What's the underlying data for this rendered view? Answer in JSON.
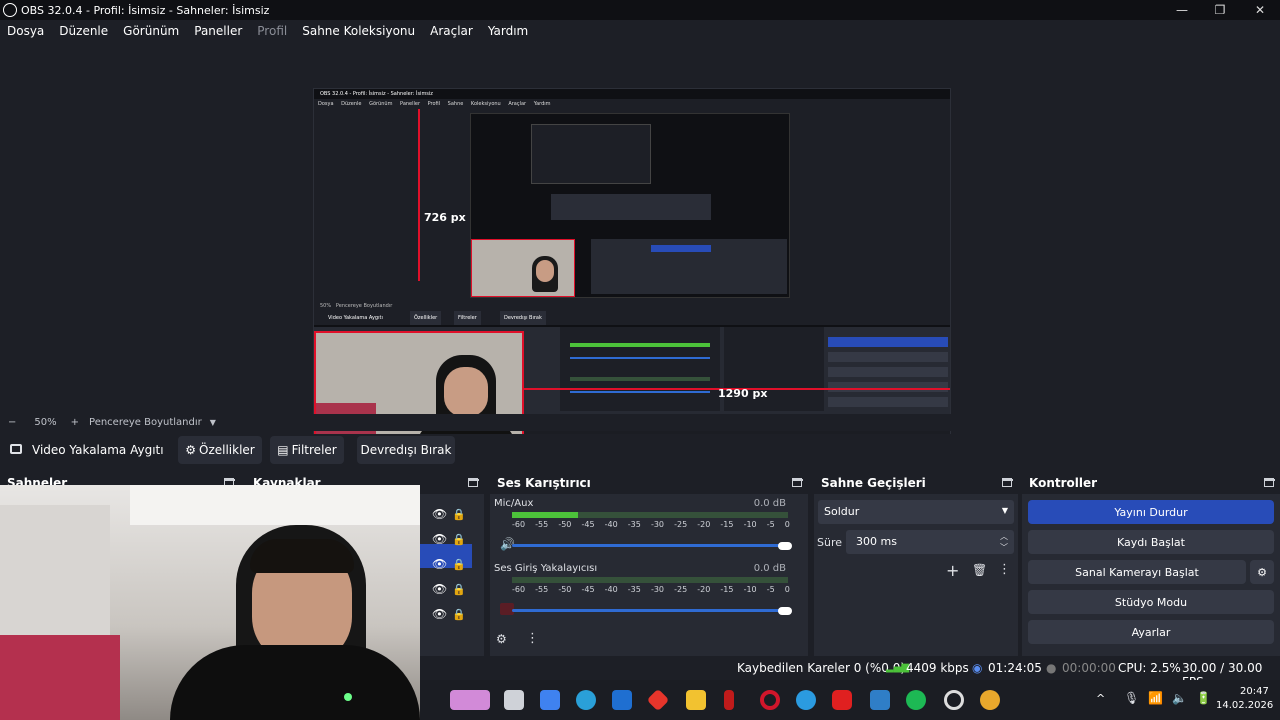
{
  "window": {
    "title": "OBS 32.0.4 - Profil: İsimsiz - Sahneler: İsimsiz",
    "minimize": "—",
    "maximize": "❐",
    "close": "✕"
  },
  "menu": [
    "Dosya",
    "Düzenle",
    "Görünüm",
    "Paneller",
    "Profil",
    "Sahne Koleksiyonu",
    "Araçlar",
    "Yardım"
  ],
  "preview": {
    "measure_vertical": "726 px",
    "measure_horizontal": "1290 px",
    "inner_title": "OBS 32.0.4 - Profil: İsimsiz - Sahneler: İsimsiz",
    "inner_zoom": "50%",
    "inner_fit": "Pencereye Boyutlandır",
    "inner_source": "Video Yakalama Aygıtı",
    "inner_props": "Özellikler",
    "inner_filters": "Filtreler",
    "inner_disable": "Devredışı Bırak"
  },
  "zoom": {
    "minus": "−",
    "value": "50%",
    "plus": "+",
    "fit_label": "Pencereye Boyutlandır"
  },
  "context": {
    "source_name": "Video Yakalama Aygıtı",
    "properties": "Özellikler",
    "filters": "Filtreler",
    "disable": "Devredışı Bırak"
  },
  "docks": {
    "scenes": "Sahneler",
    "sources": "Kaynaklar",
    "mixer": "Ses Karıştırıcı",
    "transitions": "Sahne Geçişleri",
    "controls": "Kontroller"
  },
  "mixer": {
    "tracks": [
      {
        "name": "Mic/Aux",
        "db": "0.0 dB",
        "level": 0.24
      },
      {
        "name": "Ses Giriş Yakalayıcısı",
        "db": "0.0 dB",
        "level": 0.0
      }
    ],
    "ticks": [
      "-60",
      "-55",
      "-50",
      "-45",
      "-40",
      "-35",
      "-30",
      "-25",
      "-20",
      "-15",
      "-10",
      "-5",
      "0"
    ]
  },
  "transitions": {
    "selected": "Soldur",
    "duration_label": "Süre",
    "duration_value": "300 ms"
  },
  "controls": {
    "stop_stream": "Yayını Durdur",
    "start_record": "Kaydı Başlat",
    "virtual_cam": "Sanal Kamerayı Başlat",
    "studio_mode": "Stüdyo Modu",
    "settings": "Ayarlar"
  },
  "status": {
    "dropped_frames": "Kaybedilen Kareler 0 (%0.0)",
    "bitrate": "4409 kbps",
    "stream_time": "01:24:05",
    "record_time": "00:00:00",
    "cpu": "CPU: 2.5%",
    "fps": "30.00 / 30.00 FPS"
  },
  "clock": {
    "time": "20:47",
    "date": "14.02.2026"
  },
  "colors": {
    "accent": "#284cb8",
    "live_red": "#e0102a",
    "meter_green": "#4cc23a"
  }
}
